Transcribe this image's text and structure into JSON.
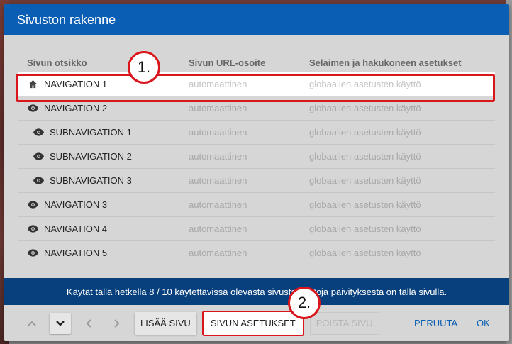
{
  "dialog": {
    "title": "Sivuston rakenne"
  },
  "table": {
    "headers": [
      "Sivun otsikko",
      "Sivun URL-osoite",
      "Selaimen ja hakukoneen asetukset"
    ],
    "rows": [
      {
        "icon": "home-icon",
        "name": "NAVIGATION 1",
        "url": "automaattinen",
        "settings": "globaalien asetusten käyttö",
        "indent": false,
        "active": true
      },
      {
        "icon": "eye-icon",
        "name": "NAVIGATION 2",
        "url": "automaattinen",
        "settings": "globaalien asetusten käyttö",
        "indent": false,
        "active": false
      },
      {
        "icon": "eye-icon",
        "name": "SUBNAVIGATION 1",
        "url": "automaattinen",
        "settings": "globaalien asetusten käyttö",
        "indent": true,
        "active": false
      },
      {
        "icon": "eye-icon",
        "name": "SUBNAVIGATION 2",
        "url": "automaattinen",
        "settings": "globaalien asetusten käyttö",
        "indent": true,
        "active": false
      },
      {
        "icon": "eye-icon",
        "name": "SUBNAVIGATION 3",
        "url": "automaattinen",
        "settings": "globaalien asetusten käyttö",
        "indent": true,
        "active": false
      },
      {
        "icon": "eye-icon",
        "name": "NAVIGATION 3",
        "url": "automaattinen",
        "settings": "globaalien asetusten käyttö",
        "indent": false,
        "active": false
      },
      {
        "icon": "eye-icon",
        "name": "NAVIGATION 4",
        "url": "automaattinen",
        "settings": "globaalien asetusten käyttö",
        "indent": false,
        "active": false
      },
      {
        "icon": "eye-icon",
        "name": "NAVIGATION 5",
        "url": "automaattinen",
        "settings": "globaalien asetusten käyttö",
        "indent": false,
        "active": false
      }
    ]
  },
  "info": {
    "text": "Käytät tällä hetkellä 8 / 10 käytettävissä olevasta sivusta. Tietoja päivityksestä on tällä sivulla."
  },
  "footer": {
    "add_label": "LISÄÄ SIVU",
    "settings_label": "SIVUN ASETUKSET",
    "delete_label": "POISTA SIVU",
    "cancel_label": "PERUUTA",
    "ok_label": "OK"
  },
  "callouts": {
    "one": "1.",
    "two": "2."
  },
  "colors": {
    "header": "#0a5fb4",
    "info_bar": "#07407d",
    "highlight": "#d9161c"
  }
}
